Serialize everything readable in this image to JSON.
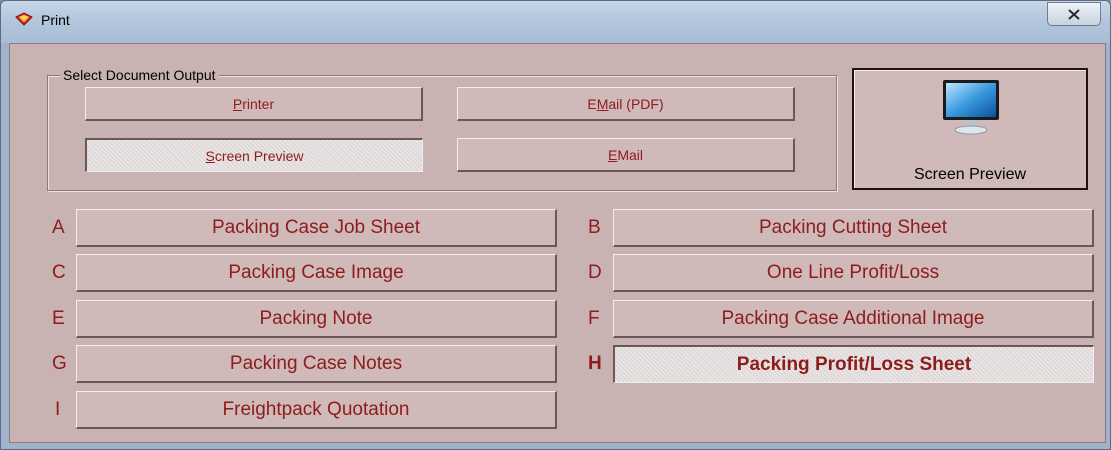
{
  "window": {
    "title": "Print"
  },
  "output_group": {
    "legend": "Select Document Output",
    "printer": {
      "pre": "",
      "key": "P",
      "post": "rinter"
    },
    "email_pdf": {
      "pre": "E ",
      "key": "M",
      "post": "ail (PDF)"
    },
    "screen_preview": {
      "pre": "",
      "key": "S",
      "post": "creen Preview"
    },
    "email": {
      "pre": "",
      "key": "E",
      "post": " Mail"
    }
  },
  "preview_button": {
    "label": "Screen Preview",
    "icon": "monitor-icon"
  },
  "reports": [
    {
      "letter": "A",
      "label": "Packing Case Job Sheet"
    },
    {
      "letter": "B",
      "label": "Packing Cutting Sheet"
    },
    {
      "letter": "C",
      "label": "Packing Case Image"
    },
    {
      "letter": "D",
      "label": "One Line Profit/Loss"
    },
    {
      "letter": "E",
      "label": "Packing Note"
    },
    {
      "letter": "F",
      "label": "Packing Case Additional Image"
    },
    {
      "letter": "G",
      "label": "Packing Case Notes"
    },
    {
      "letter": "H",
      "label": "Packing Profit/Loss Sheet"
    },
    {
      "letter": "I",
      "label": "Freightpack Quotation"
    }
  ],
  "colors": {
    "dialog_bg": "#c9b2b2",
    "label_color": "#8e1c1c"
  }
}
